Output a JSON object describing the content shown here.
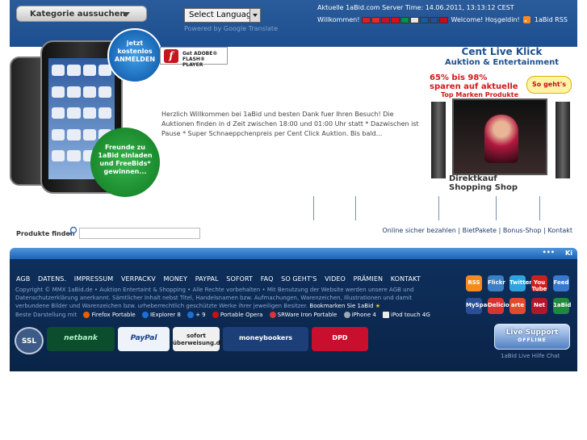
{
  "header": {
    "category_button": "Kategorie aussuchen",
    "language_select": "Select Language",
    "powered_by": "Powered by Google Translate",
    "server_time": "Aktuelle 1aBid.com Server Time: 14.06.2011, 13:13:12 CEST",
    "welcome_left": "Willkommen!",
    "welcome_right": "Welcome! Hoşgeldin!",
    "rss_label": "1aBid RSS",
    "flags": [
      "#d5202a",
      "#e42b2b",
      "#c8102e",
      "#e30a17",
      "#009246",
      "#e6e6e6",
      "#0d5eaf",
      "#1f4fa0",
      "#c60b1e"
    ]
  },
  "hero": {
    "badge_top": [
      "jetzt",
      "kostenlos",
      "ANMELDEN"
    ],
    "badge_bottom": [
      "Freunde zu",
      "1aBid einladen",
      "und FreeBids*",
      "gewinnen..."
    ],
    "flash_line1": "Get ADOBE®",
    "flash_line2": "FLASH® PLAYER",
    "intro_text": "Herzlich Willkommen bei 1aBid und besten Dank fuer Ihren Besuch! Die Auktionen finden in d Zeit zwischen 18:00 und 01:00 Uhr statt * Dazwischen ist Pause * Super Schnaeppchenpreis per Cent Click Auktion. Bis bald..."
  },
  "promo": {
    "title": "Cent Live Klick",
    "subtitle": "Auktion & Entertainment",
    "percent_line1": "65% bis 98%",
    "percent_line2": "sparen auf aktuelle",
    "marken": "Top Marken Produkte",
    "sogehts": "So geht's",
    "direkt_line1": "Direktkauf",
    "direkt_line2": "Shopping Shop"
  },
  "search": {
    "label": "Produkte finden",
    "placeholder": ""
  },
  "quick_links": [
    "Online sicher bezahlen",
    "BietPakete",
    "Bonus-Shop",
    "Kontakt"
  ],
  "blue_bar": {
    "dots": "•••",
    "right_text": "Ki"
  },
  "footer": {
    "nav": [
      "AGB",
      "DATENS.",
      "IMPRESSUM",
      "VERPACKV",
      "MONEY",
      "PAYPAL",
      "SOFORT",
      "FAQ",
      "SO GEHT'S",
      "VIDEO",
      "PRÄMIEN",
      "KONTAKT"
    ],
    "copyright": "Copyright © MMX 1aBid.de • Auktion Entertaint & Shopping • Alle Rechte vorbehalten • Mit Benutzung der Website werden unsere AGB und Datenschutzerklärung anerkannt. Sämtlicher Inhalt nebst Titel, Handelsnamen bzw. Aufmachungen, Warenzeichen, Illustrationen und damit verbundene Bilder und Warenzeichen bzw. urheberrechtlich geschützte Werke ihrer jeweiligen Besitzer.",
    "bookmark": "Bookmarken Sie 1aBid",
    "browsers_label": "Beste Darstellung mit",
    "browsers": [
      "Firefox Portable",
      "IExplorer 8",
      "+ 9",
      "Portable Opera",
      "SRWare Iron Portable",
      "iPhone 4",
      "iPod touch 4G"
    ],
    "payments": [
      "SSL",
      "netbank",
      "PayPal",
      "sofort überweisung.de",
      "moneybookers",
      "DPD"
    ],
    "social": [
      "RSS",
      "Flickr",
      "Twitter",
      "You Tube",
      "Feed",
      "MySpace",
      "Delicious",
      "arte",
      "Net",
      "1aBid"
    ],
    "live_support_title": "Live Support",
    "live_support_status": "OFFLINE",
    "live_help": "1aBid Live Hilfe Chat"
  }
}
